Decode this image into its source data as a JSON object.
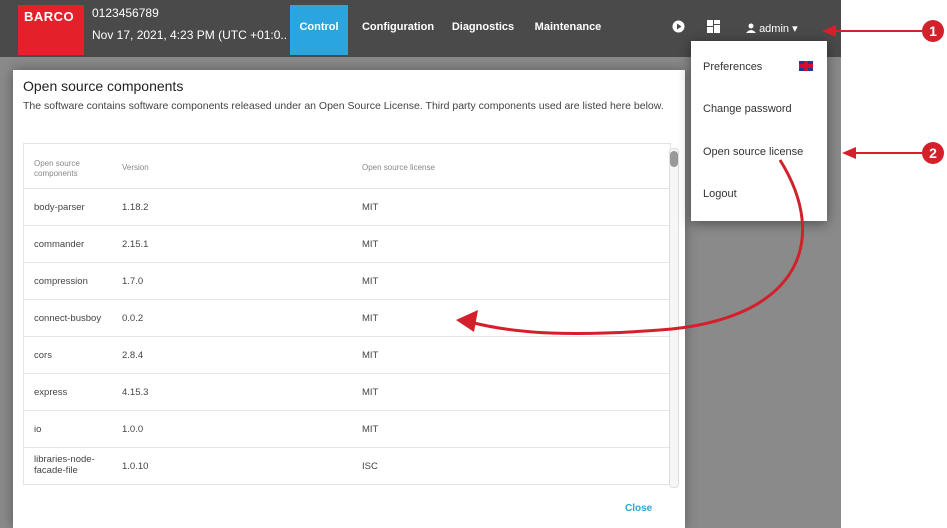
{
  "header": {
    "logo": "BARCO",
    "serial": "0123456789",
    "datetime": "Nov 17, 2021, 4:23 PM (UTC +01:0..",
    "tabs": [
      {
        "label": "Control",
        "active": true
      },
      {
        "label": "Configuration",
        "active": false
      },
      {
        "label": "Diagnostics",
        "active": false
      },
      {
        "label": "Maintenance",
        "active": false
      }
    ],
    "user": "admin",
    "accent_color": "#2aa5dd",
    "brand_color": "#e4202b"
  },
  "user_menu": {
    "items": [
      {
        "label": "Preferences"
      },
      {
        "label": "Change password"
      },
      {
        "label": "Open source license"
      },
      {
        "label": "Logout"
      }
    ]
  },
  "modal": {
    "title": "Open source components",
    "description": "The software contains software components released under an Open Source License. Third party components used are listed here below.",
    "columns": [
      "Open source components",
      "Version",
      "Open source license"
    ],
    "rows": [
      {
        "name": "body-parser",
        "version": "1.18.2",
        "license": "MIT"
      },
      {
        "name": "commander",
        "version": "2.15.1",
        "license": "MIT"
      },
      {
        "name": "compression",
        "version": "1.7.0",
        "license": "MIT"
      },
      {
        "name": "connect-busboy",
        "version": "0.0.2",
        "license": "MIT"
      },
      {
        "name": "cors",
        "version": "2.8.4",
        "license": "MIT"
      },
      {
        "name": "express",
        "version": "4.15.3",
        "license": "MIT"
      },
      {
        "name": "io",
        "version": "1.0.0",
        "license": "MIT"
      },
      {
        "name": "libraries-node-facade-file",
        "version": "1.0.10",
        "license": "ISC"
      }
    ],
    "close_label": "Close"
  },
  "callouts": [
    "1",
    "2"
  ]
}
